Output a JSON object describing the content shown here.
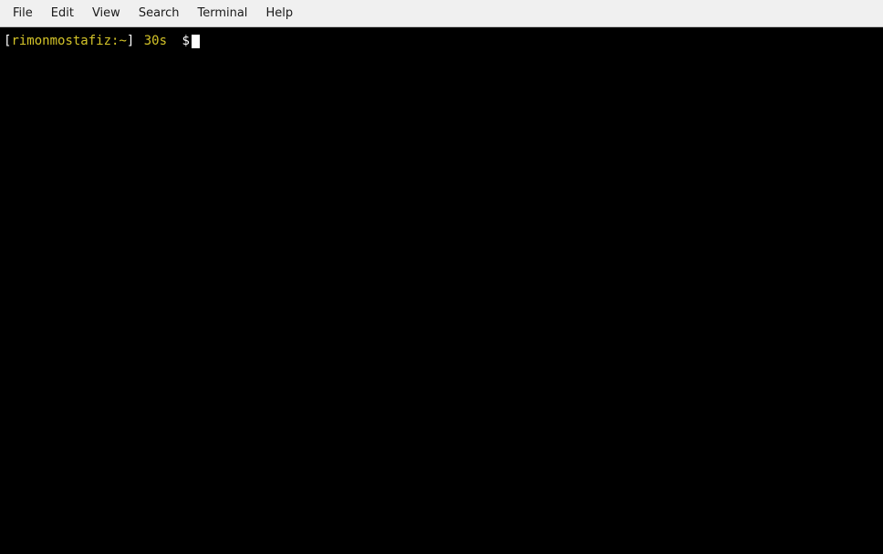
{
  "menubar": {
    "items": [
      {
        "id": "file",
        "label": "File"
      },
      {
        "id": "edit",
        "label": "Edit"
      },
      {
        "id": "view",
        "label": "View"
      },
      {
        "id": "search",
        "label": "Search"
      },
      {
        "id": "terminal",
        "label": "Terminal"
      },
      {
        "id": "help",
        "label": "Help"
      }
    ]
  },
  "terminal": {
    "prompt": {
      "bracket_left": "[",
      "username_host": "rimonmostafiz:~",
      "bracket_right": "]",
      "time": "30s",
      "dollar": "$"
    }
  }
}
